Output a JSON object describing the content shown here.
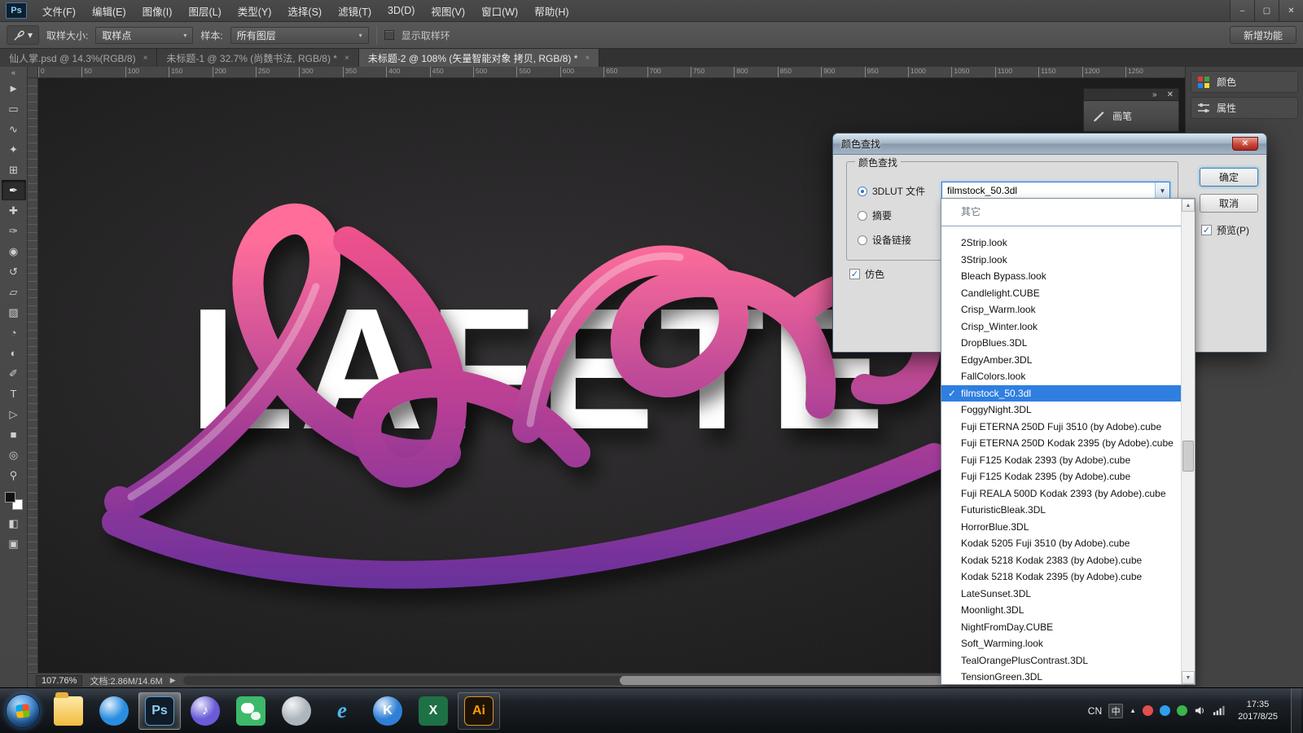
{
  "colors": {
    "selection_blue": "#2f7fe0",
    "combo_focus_blue": "#2a7bd4",
    "tube_pink": "#f9558a",
    "tube_purple": "#4f2b9e",
    "wechat_green": "#3db96a",
    "ps_blue": "#8ecdf5",
    "ai_orange": "#ff9a00"
  },
  "window": {
    "controls": [
      {
        "name": "minimize-button",
        "glyph": "–"
      },
      {
        "name": "restore-button",
        "glyph": "▢"
      },
      {
        "name": "close-button",
        "glyph": "✕"
      }
    ]
  },
  "menu": {
    "logo": "Ps",
    "items": [
      {
        "name": "menu-file",
        "label": "文件(F)"
      },
      {
        "name": "menu-edit",
        "label": "编辑(E)"
      },
      {
        "name": "menu-image",
        "label": "图像(I)"
      },
      {
        "name": "menu-layer",
        "label": "图层(L)"
      },
      {
        "name": "menu-type",
        "label": "类型(Y)"
      },
      {
        "name": "menu-select",
        "label": "选择(S)"
      },
      {
        "name": "menu-filter",
        "label": "滤镜(T)"
      },
      {
        "name": "menu-3d",
        "label": "3D(D)"
      },
      {
        "name": "menu-view",
        "label": "视图(V)"
      },
      {
        "name": "menu-window",
        "label": "窗口(W)"
      },
      {
        "name": "menu-help",
        "label": "帮助(H)"
      }
    ]
  },
  "options": {
    "tool_arrow": "▾",
    "sample_size_label": "取样大小:",
    "sample_size_value": "取样点",
    "sample_label": "样本:",
    "sample_value": "所有图层",
    "dd_arrow": "▾",
    "show_ring_label": "显示取样环",
    "new_features_label": "新增功能"
  },
  "tabs": {
    "items": [
      {
        "name": "tab-document-1",
        "label": "仙人掌.psd @ 14.3%(RGB/8)",
        "close": "×"
      },
      {
        "name": "tab-document-2",
        "label": "未标题-1 @ 32.7% (尚魏书法, RGB/8) *",
        "close": "×"
      },
      {
        "name": "tab-document-3",
        "label": "未标题-2 @ 108% (矢量智能对象 拷贝, RGB/8) *",
        "close": "×",
        "state": "active"
      }
    ]
  },
  "ruler": {
    "ticks": [
      "0",
      "50",
      "100",
      "150",
      "200",
      "250",
      "300",
      "350",
      "400",
      "450",
      "500",
      "550",
      "600",
      "650",
      "700",
      "750",
      "800",
      "850",
      "900",
      "950",
      "1000",
      "1050",
      "1100",
      "1150",
      "1200",
      "1250"
    ]
  },
  "tools": {
    "collapse": "«",
    "items": [
      {
        "name": "move-tool",
        "glyph": "►"
      },
      {
        "name": "marquee-tool",
        "glyph": "▭"
      },
      {
        "name": "lasso-tool",
        "glyph": "∿"
      },
      {
        "name": "magic-wand-tool",
        "glyph": "✦"
      },
      {
        "name": "crop-tool",
        "glyph": "⊞"
      },
      {
        "name": "eyedropper-tool",
        "glyph": "✒",
        "state": "selected"
      },
      {
        "name": "healing-brush-tool",
        "glyph": "✚"
      },
      {
        "name": "brush-tool",
        "glyph": "✑"
      },
      {
        "name": "clone-stamp-tool",
        "glyph": "◉"
      },
      {
        "name": "history-brush-tool",
        "glyph": "↺"
      },
      {
        "name": "eraser-tool",
        "glyph": "▱"
      },
      {
        "name": "gradient-tool",
        "glyph": "▨"
      },
      {
        "name": "blur-tool",
        "glyph": "◔"
      },
      {
        "name": "dodge-tool",
        "glyph": "◐"
      },
      {
        "name": "pen-tool",
        "glyph": "✐"
      },
      {
        "name": "type-tool",
        "glyph": "T"
      },
      {
        "name": "path-select-tool",
        "glyph": "▷"
      },
      {
        "name": "shape-tool",
        "glyph": "■"
      },
      {
        "name": "hand-tool",
        "glyph": "◎"
      },
      {
        "name": "zoom-tool",
        "glyph": "⚲"
      }
    ],
    "quick_mask_glyph": "◧",
    "screen_mode_glyph": "▣"
  },
  "canvas": {
    "letters": "LAFETE"
  },
  "dock": {
    "color_label": "颜色",
    "properties_label": "属性",
    "brush_label": "画笔",
    "brush_expand": "»",
    "brush_close": "✕"
  },
  "dialog": {
    "title": "颜色查找",
    "close_glyph": "✕",
    "group_label": "颜色查找",
    "radio_3dlut": "3DLUT 文件",
    "radio_abstract": "摘要",
    "radio_device_link": "设备链接",
    "combo_value": "filmstock_50.3dl",
    "combo_arrow": "▼",
    "dither_label": "仿色",
    "check_glyph": "✓",
    "ok_label": "确定",
    "cancel_label": "取消",
    "preview_label": "预览(P)"
  },
  "lut": {
    "other_label": "其它",
    "scroll_up": "▲",
    "scroll_down": "▼",
    "items": [
      {
        "label": "2Strip.look"
      },
      {
        "label": "3Strip.look"
      },
      {
        "label": "Bleach Bypass.look"
      },
      {
        "label": "Candlelight.CUBE"
      },
      {
        "label": "Crisp_Warm.look"
      },
      {
        "label": "Crisp_Winter.look"
      },
      {
        "label": "DropBlues.3DL"
      },
      {
        "label": "EdgyAmber.3DL"
      },
      {
        "label": "FallColors.look"
      },
      {
        "label": "filmstock_50.3dl",
        "state": "selected",
        "check": "✓"
      },
      {
        "label": "FoggyNight.3DL"
      },
      {
        "label": "Fuji ETERNA 250D Fuji 3510 (by Adobe).cube"
      },
      {
        "label": "Fuji ETERNA 250D Kodak 2395 (by Adobe).cube"
      },
      {
        "label": "Fuji F125 Kodak 2393 (by Adobe).cube"
      },
      {
        "label": "Fuji F125 Kodak 2395 (by Adobe).cube"
      },
      {
        "label": "Fuji REALA 500D Kodak 2393 (by Adobe).cube"
      },
      {
        "label": "FuturisticBleak.3DL"
      },
      {
        "label": "HorrorBlue.3DL"
      },
      {
        "label": "Kodak 5205 Fuji 3510 (by Adobe).cube"
      },
      {
        "label": "Kodak 5218 Kodak 2383 (by Adobe).cube"
      },
      {
        "label": "Kodak 5218 Kodak 2395 (by Adobe).cube"
      },
      {
        "label": "LateSunset.3DL"
      },
      {
        "label": "Moonlight.3DL"
      },
      {
        "label": "NightFromDay.CUBE"
      },
      {
        "label": "Soft_Warming.look"
      },
      {
        "label": "TealOrangePlusContrast.3DL"
      },
      {
        "label": "TensionGreen.3DL"
      }
    ]
  },
  "status": {
    "zoom": "107.76%",
    "doc": "文档:2.86M/14.6M",
    "arrow": "▶"
  },
  "taskbar": {
    "apps": [
      {
        "name": "taskbar-explorer",
        "cls": "folder"
      },
      {
        "name": "taskbar-browser-sphere",
        "cls": "sphere",
        "bg": "#2a8de0"
      },
      {
        "name": "taskbar-photoshop",
        "cls": "ps-tile",
        "glyph": "Ps",
        "bg": "#101c28",
        "fg": "#8ecdf5",
        "state": "active"
      },
      {
        "name": "taskbar-music-app",
        "cls": "sphere",
        "glyph": "♪",
        "bg": "#6a5bd8",
        "fg": "#ffffff"
      },
      {
        "name": "taskbar-wechat",
        "cls": "wechat",
        "bg": "#3db96a"
      },
      {
        "name": "taskbar-contact-app",
        "cls": "sphere",
        "bg": "#aeb6bd"
      },
      {
        "name": "taskbar-ie",
        "cls": "plain",
        "glyph": "e",
        "fg": "#4db8f0"
      },
      {
        "name": "taskbar-k-app",
        "cls": "sphere",
        "glyph": "K",
        "bg": "#2f7fd6",
        "fg": "#ffffff"
      },
      {
        "name": "taskbar-excel",
        "cls": "tile",
        "glyph": "X",
        "bg": "#1e7145",
        "fg": "#ffffff"
      },
      {
        "name": "taskbar-illustrator",
        "cls": "ai-tile",
        "glyph": "Ai",
        "bg": "#1d1407",
        "fg": "#ff9a00",
        "state": "open"
      }
    ],
    "tray": {
      "lang": "CN",
      "ime": "中",
      "hidden_arrow": "▲",
      "time": "17:35",
      "date": "2017/8/25"
    }
  }
}
